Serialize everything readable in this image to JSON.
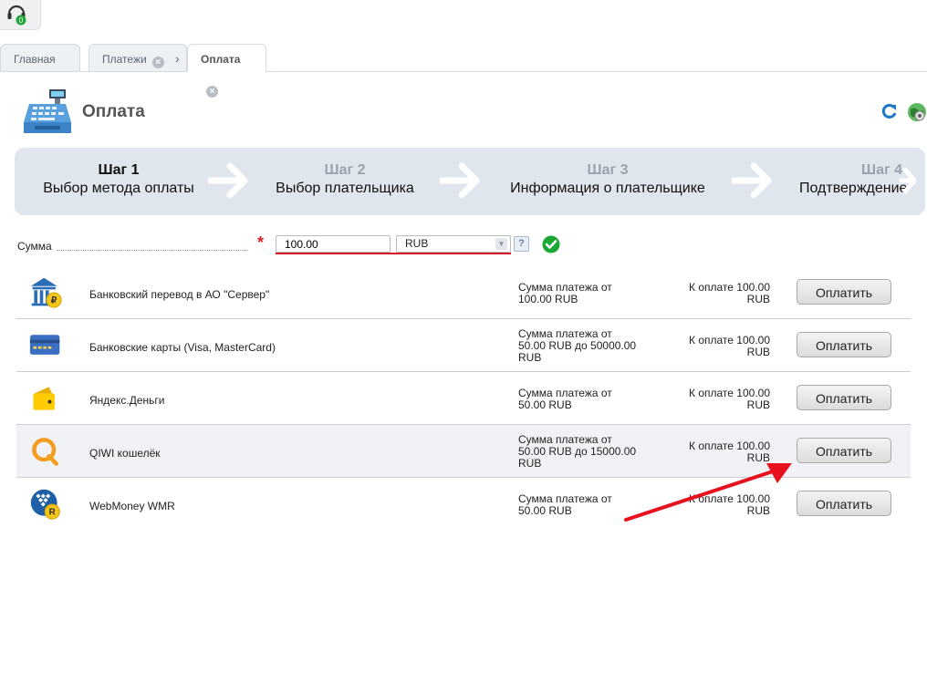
{
  "topbar": {
    "badge": "0"
  },
  "tabs": [
    {
      "label": "Главная"
    },
    {
      "label": "Платежи"
    },
    {
      "label": "Оплата"
    }
  ],
  "page": {
    "title": "Оплата"
  },
  "steps": [
    {
      "num": "Шаг 1",
      "label": "Выбор метода оплаты"
    },
    {
      "num": "Шаг 2",
      "label": "Выбор плательщика"
    },
    {
      "num": "Шаг 3",
      "label": "Информация о плательщике"
    },
    {
      "num": "Шаг 4",
      "label": "Подтверждение"
    }
  ],
  "amount": {
    "label": "Сумма",
    "required_mark": "*",
    "value": "100.00",
    "currency": "RUB",
    "help": "?"
  },
  "methods": [
    {
      "name": "Банковский перевод в АО \"Сервер\"",
      "limits": [
        "Сумма платежа от",
        "100.00 RUB"
      ],
      "due": [
        "К оплате 100.00",
        "RUB"
      ],
      "button": "Оплатить"
    },
    {
      "name": "Банковские карты (Visa, MasterCard)",
      "limits": [
        "Сумма платежа от",
        "50.00 RUB до 50000.00",
        "RUB"
      ],
      "due": [
        "К оплате 100.00",
        "RUB"
      ],
      "button": "Оплатить"
    },
    {
      "name": "Яндекс.Деньги",
      "limits": [
        "Сумма платежа от",
        "50.00 RUB"
      ],
      "due": [
        "К оплате 100.00",
        "RUB"
      ],
      "button": "Оплатить"
    },
    {
      "name": "QIWI кошелёк",
      "limits": [
        "Сумма платежа от",
        "50.00 RUB до 15000.00",
        "RUB"
      ],
      "due": [
        "К оплате 100.00",
        "RUB"
      ],
      "button": "Оплатить"
    },
    {
      "name": "WebMoney WMR",
      "limits": [
        "Сумма платежа от",
        "50.00 RUB"
      ],
      "due": [
        "К оплате 100.00",
        "RUB"
      ],
      "button": "Оплатить"
    }
  ],
  "colors": {
    "accent_red": "#d7182a",
    "steps_bg": "#dfe6ed",
    "ok_green": "#1ba832"
  }
}
